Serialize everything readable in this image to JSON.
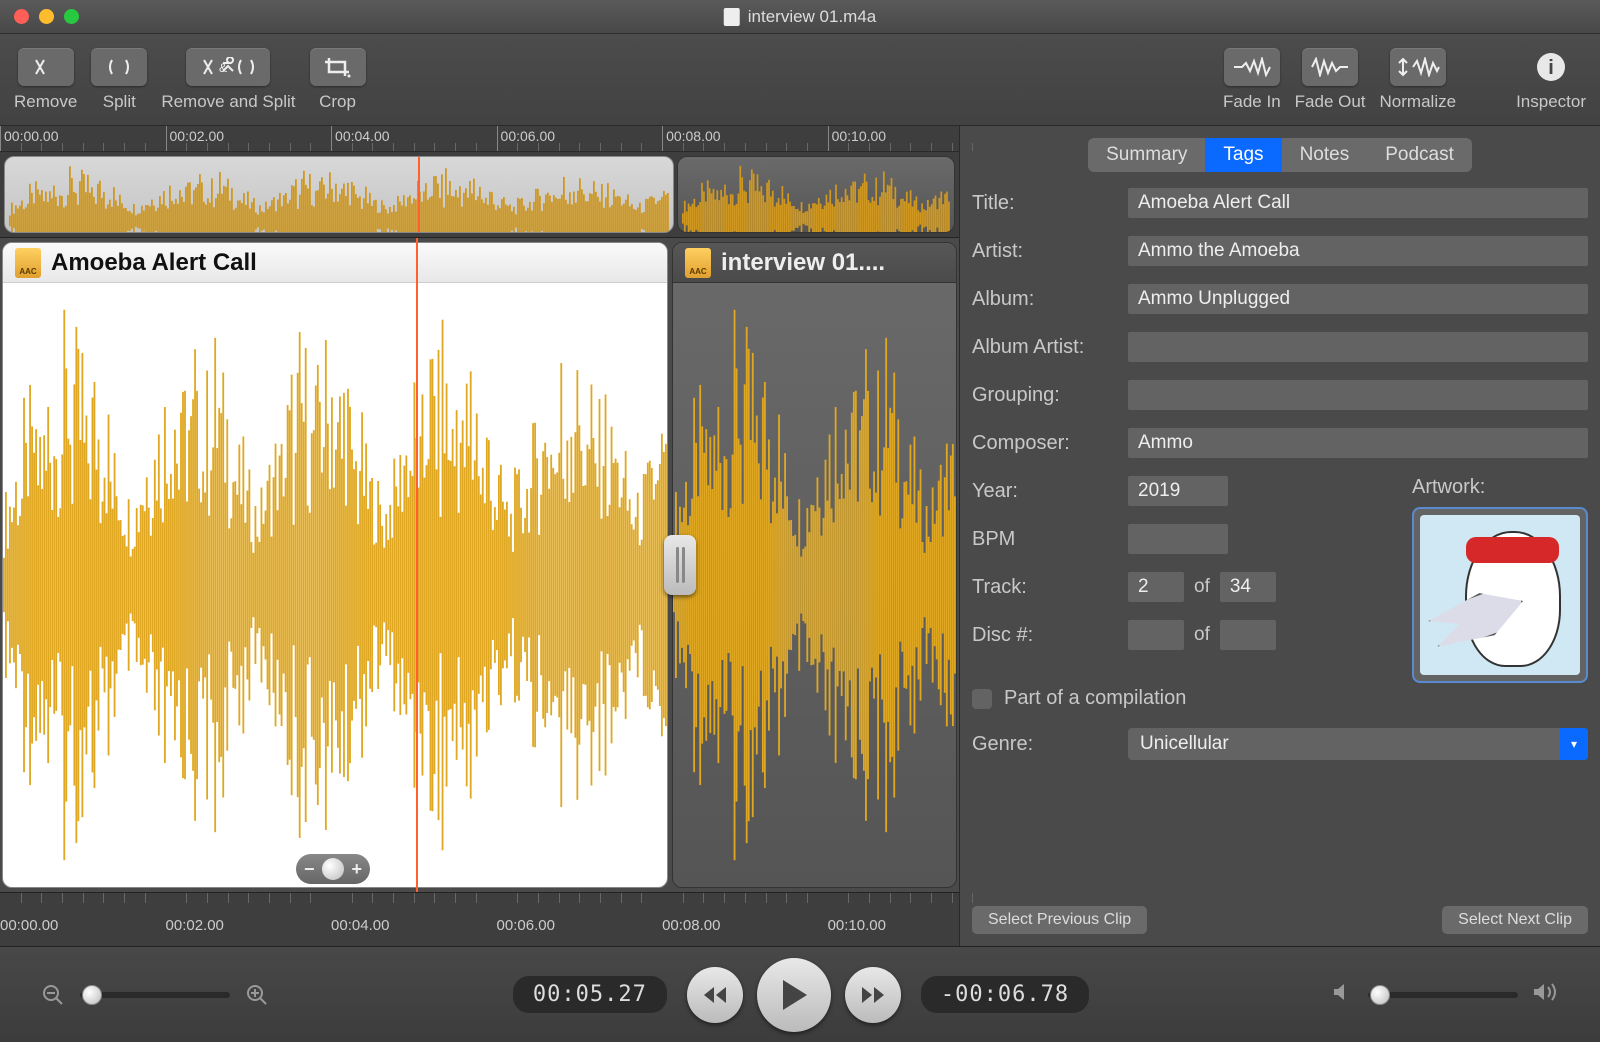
{
  "window": {
    "title": "interview 01.m4a"
  },
  "toolbar": {
    "remove": "Remove",
    "split": "Split",
    "remove_split": "Remove and Split",
    "crop": "Crop",
    "fade_in": "Fade In",
    "fade_out": "Fade Out",
    "normalize": "Normalize",
    "inspector": "Inspector"
  },
  "ruler_ticks": [
    "00:00.00",
    "00:02.00",
    "00:04.00",
    "00:06.00",
    "00:08.00",
    "00:10.00"
  ],
  "clips": {
    "a": {
      "title": "Amoeba Alert Call",
      "format": "AAC"
    },
    "b": {
      "title": "interview 01....",
      "format": "AAC"
    }
  },
  "inspector_tabs": {
    "summary": "Summary",
    "tags": "Tags",
    "notes": "Notes",
    "podcast": "Podcast"
  },
  "tags": {
    "labels": {
      "title": "Title:",
      "artist": "Artist:",
      "album": "Album:",
      "album_artist": "Album Artist:",
      "grouping": "Grouping:",
      "composer": "Composer:",
      "year": "Year:",
      "bpm": "BPM",
      "track": "Track:",
      "disc": "Disc #:",
      "artwork": "Artwork:",
      "of": "of",
      "compilation": "Part of a compilation",
      "genre": "Genre:"
    },
    "values": {
      "title": "Amoeba Alert Call",
      "artist": "Ammo the Amoeba",
      "album": "Ammo Unplugged",
      "album_artist": "",
      "grouping": "",
      "composer": "Ammo",
      "year": "2019",
      "bpm": "",
      "track_no": "2",
      "track_total": "34",
      "disc_no": "",
      "disc_total": "",
      "genre": "Unicellular"
    }
  },
  "nav": {
    "prev": "Select Previous Clip",
    "next": "Select Next Clip"
  },
  "transport": {
    "current": "00:05.27",
    "remaining": "-00:06.78"
  }
}
